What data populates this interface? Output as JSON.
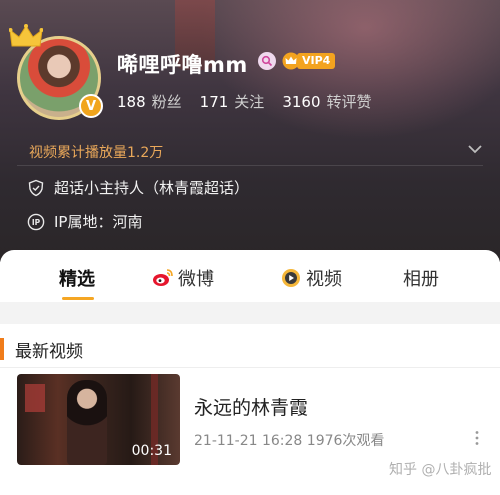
{
  "profile": {
    "username": "唏哩呼噜mm",
    "vip_label": "VIP4",
    "verified_mark": "V",
    "stats": [
      {
        "num": "188",
        "label": "粉丝"
      },
      {
        "num": "171",
        "label": "关注"
      },
      {
        "num": "3160",
        "label": "转评赞"
      }
    ],
    "video_plays": "视频累计播放量1.2万",
    "role": "超话小主持人（林青霞超话）",
    "ip_location": "IP属地：河南",
    "icons": [
      "crown-icon",
      "search-badge-icon",
      "vip-crown-icon",
      "chevron-down-icon",
      "shield-icon",
      "ip-icon"
    ]
  },
  "tabs": [
    {
      "label": "精选",
      "active": true
    },
    {
      "label": "微博",
      "icon": "weibo-icon"
    },
    {
      "label": "视频",
      "icon": "video-icon"
    },
    {
      "label": "相册"
    }
  ],
  "section": {
    "title": "最新视频"
  },
  "video": {
    "title": "永远的林青霞",
    "duration": "00:31",
    "meta": "21-11-21 16:28 1976次观看"
  },
  "watermark": "知乎 @八卦疯批",
  "colors": {
    "accent": "#f5a623",
    "section_bar": "#f07c1a",
    "play_count": "#e9a85a",
    "vip": "#f3a31f"
  }
}
